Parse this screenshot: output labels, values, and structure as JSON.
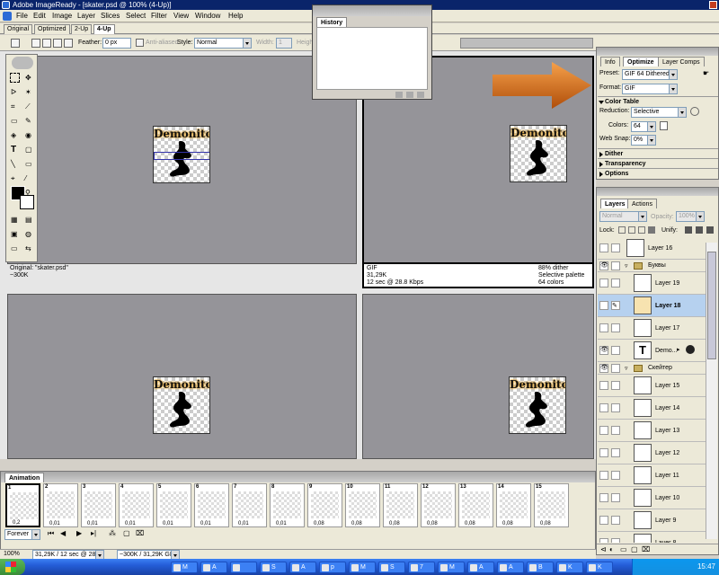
{
  "app": {
    "title": "Adobe ImageReady - [skater.psd @ 100% (4-Up)]"
  },
  "menu": [
    "File",
    "Edit",
    "Image",
    "Layer",
    "Slices",
    "Select",
    "Filter",
    "View",
    "Window",
    "Help"
  ],
  "doc_tabs": [
    "Original",
    "Optimized",
    "2-Up",
    "4-Up"
  ],
  "options": {
    "feather_label": "Feather:",
    "feather_value": "0 px",
    "antialiased_label": "Anti-aliased",
    "style_label": "Style:",
    "style_value": "Normal",
    "width_label": "Width:",
    "width_value": "1",
    "height_label": "Height"
  },
  "canvas": {
    "wordmark": "Demonito",
    "pane1": {
      "line1": "Original: \"skater.psd\"",
      "line2": "~300K"
    },
    "pane2": {
      "format": "GIF",
      "size": "31,29K",
      "time": "12 sec @ 28.8 Kbps",
      "dither": "88% dither",
      "palette": "Selective palette",
      "colors": "64 colors"
    }
  },
  "history": {
    "title": "History"
  },
  "optimize": {
    "tabs": [
      "Info",
      "Optimize",
      "Layer Comps"
    ],
    "preset_label": "Preset:",
    "preset_value": "GIF 64 Dithered",
    "format_label": "Format:",
    "format_value": "GIF",
    "color_table": "Color Table",
    "reduction_label": "Reduction:",
    "reduction_value": "Selective",
    "colors_label": "Colors:",
    "colors_value": "64",
    "websnap_label": "Web Snap:",
    "websnap_value": "0%",
    "dither": "Dither",
    "transparency": "Transparency",
    "options": "Options"
  },
  "layers": {
    "tabs": [
      "Layers",
      "Actions"
    ],
    "blend": "Normal",
    "opacity_label": "Opacity:",
    "opacity_value": "100%",
    "lock_label": "Lock:",
    "unify_label": "Unify:",
    "rows": [
      {
        "name": "Layer 16"
      },
      {
        "name": "Буквы"
      },
      {
        "name": "Layer 19"
      },
      {
        "name": "Layer 18"
      },
      {
        "name": "Layer 17"
      },
      {
        "name": "Demo..."
      },
      {
        "name": "Скейтер"
      },
      {
        "name": "Layer 15"
      },
      {
        "name": "Layer 14"
      },
      {
        "name": "Layer 13"
      },
      {
        "name": "Layer 12"
      },
      {
        "name": "Layer 11"
      },
      {
        "name": "Layer 10"
      },
      {
        "name": "Layer 9"
      },
      {
        "name": "Layer 8"
      }
    ]
  },
  "animation": {
    "title": "Animation",
    "loop": "Forever",
    "frames": [
      {
        "n": "1",
        "d": "0,2"
      },
      {
        "n": "2",
        "d": "0,01"
      },
      {
        "n": "3",
        "d": "0,01"
      },
      {
        "n": "4",
        "d": "0,01"
      },
      {
        "n": "5",
        "d": "0,01"
      },
      {
        "n": "6",
        "d": "0,01"
      },
      {
        "n": "7",
        "d": "0,01"
      },
      {
        "n": "8",
        "d": "0,01"
      },
      {
        "n": "9",
        "d": "0,08"
      },
      {
        "n": "10",
        "d": "0,08"
      },
      {
        "n": "11",
        "d": "0,08"
      },
      {
        "n": "12",
        "d": "0,08"
      },
      {
        "n": "13",
        "d": "0,08"
      },
      {
        "n": "14",
        "d": "0,08"
      },
      {
        "n": "15",
        "d": "0,08"
      }
    ]
  },
  "status": {
    "zoom": "100%",
    "size": "31,29K / 12 sec @ 28.8 K...",
    "orig": "~300K / 31,29K GIF"
  },
  "taskbar": {
    "start": "",
    "items": [
      "",
      "M",
      "A",
      "",
      "S",
      "A",
      "p",
      "M",
      "S",
      "7",
      "M",
      "A",
      "A",
      "B",
      "K"
    ],
    "clock": "15:47"
  },
  "colors": {
    "title_bg": "#0a246a",
    "arrow": "#e8761c",
    "selected_layer": "#b6d1ef"
  }
}
